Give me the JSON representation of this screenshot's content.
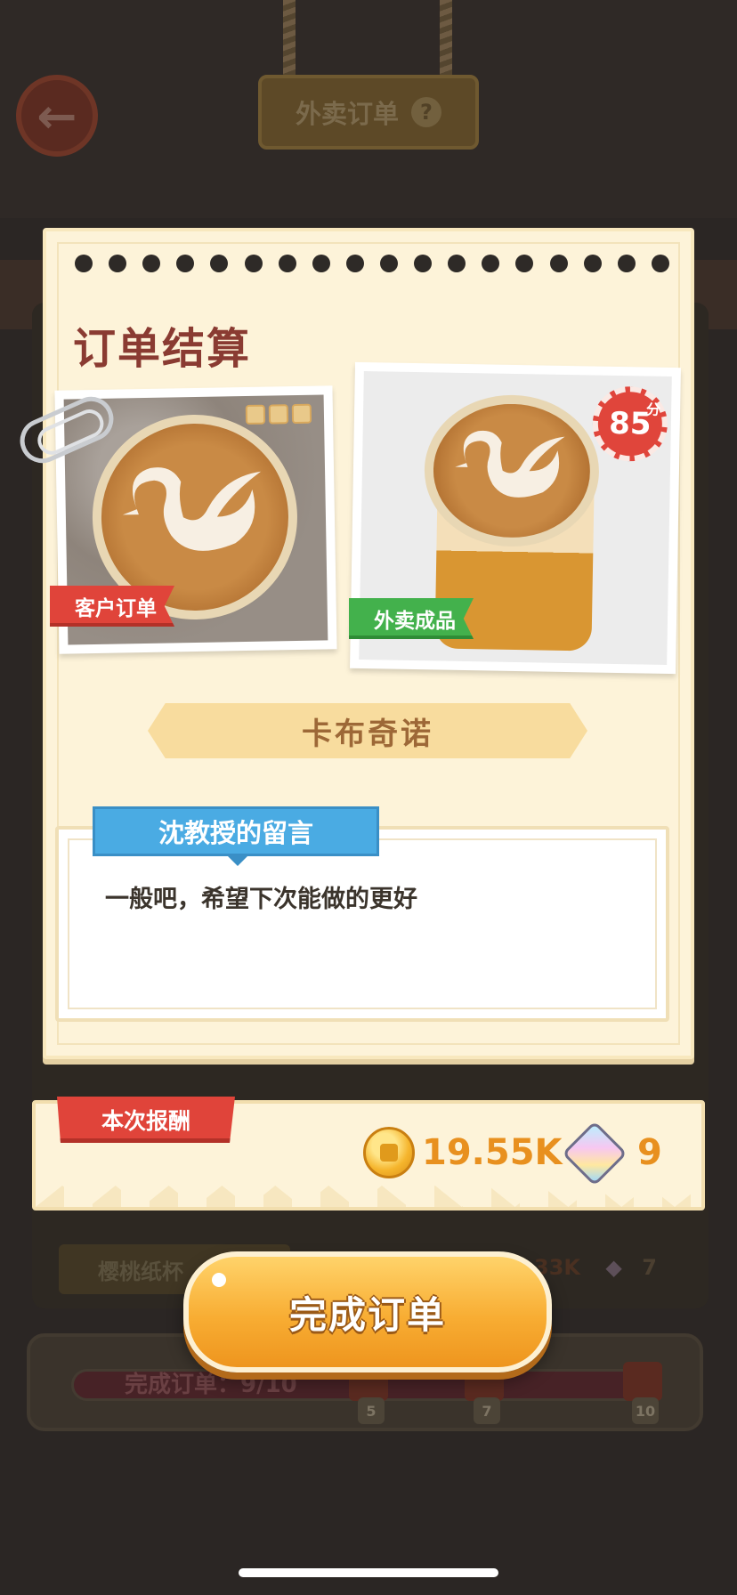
{
  "background": {
    "header_title": "外卖订单",
    "help_glyph": "?",
    "back_glyph": "←",
    "list_item_label": "樱桃纸杯",
    "list_item_reward_partial": "33K",
    "list_item_gem_count": "7",
    "progress_label": "完成订单：9/10",
    "milestones": [
      "5",
      "7",
      "10"
    ]
  },
  "dialog": {
    "title": "订单结算",
    "customer_ribbon": "客户订单",
    "product_ribbon": "外卖成品",
    "score": "85",
    "score_unit": "分",
    "product_name": "卡布奇诺",
    "message_title": "沈教授的留言",
    "message_text": "一般吧，希望下次能做的更好"
  },
  "reward": {
    "label": "本次报酬",
    "coins": "19.55K",
    "gems": "9"
  },
  "actions": {
    "complete_label": "完成订单"
  },
  "colors": {
    "accent_red": "#e0443a",
    "accent_green": "#43b14c",
    "accent_blue": "#4aabe3",
    "coin_text": "#e8901f",
    "button_orange": "#f8ad33"
  },
  "icons": [
    "back-arrow-icon",
    "help-icon",
    "coin-icon",
    "gem-icon",
    "gift-icon",
    "paperclip-icon"
  ]
}
